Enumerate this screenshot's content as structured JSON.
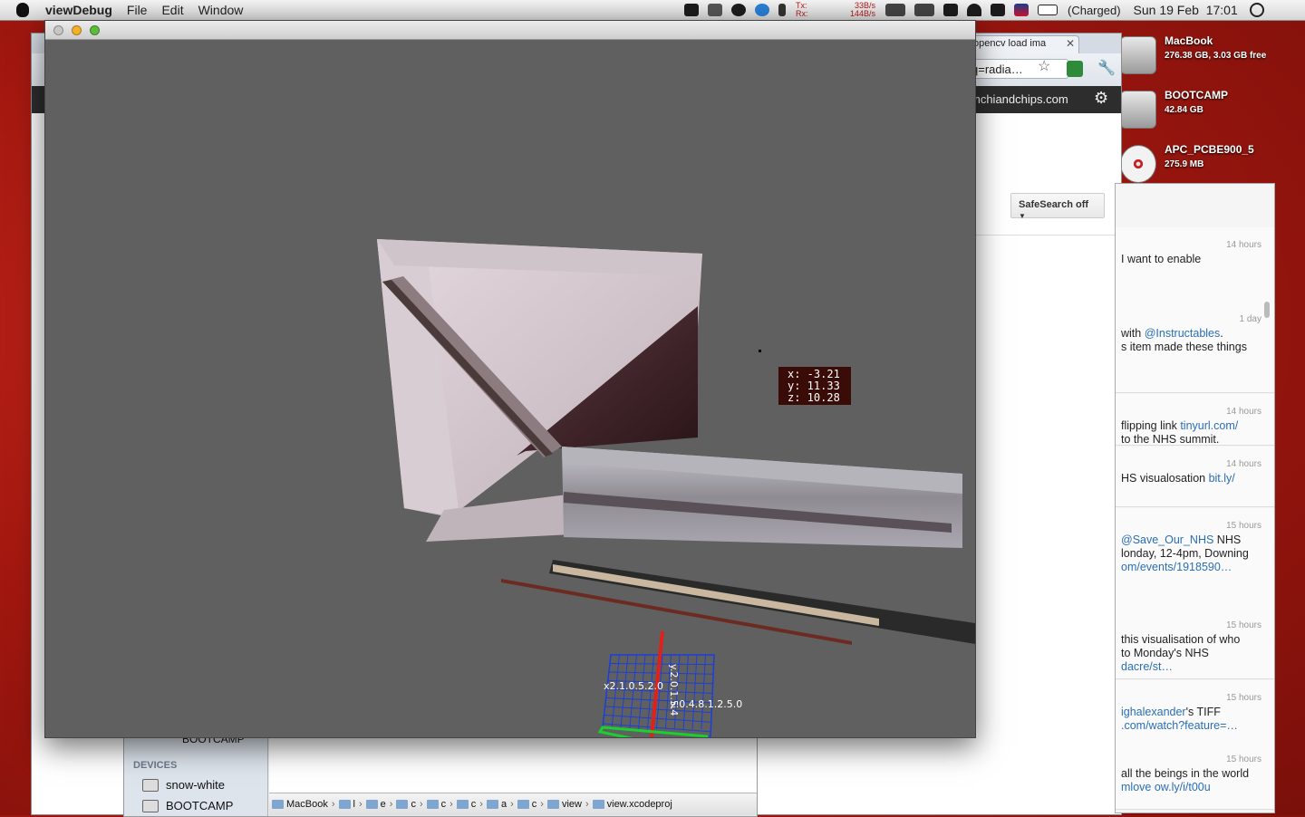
{
  "menubar": {
    "app_name": "viewDebug",
    "menus": [
      "File",
      "Edit",
      "Window"
    ],
    "net": {
      "tx_label": "Tx:",
      "tx_value": "33B/s",
      "rx_label": "Rx:",
      "rx_value": "144B/s"
    },
    "battery": "(Charged)",
    "clock": "Sun 19 Feb  17:01",
    "icons": [
      "dropbox-icon",
      "keyboard-icon",
      "lifesaver-icon",
      "twitter-bird-icon",
      "bluetooth-icon",
      "activity-graph-icon",
      "display-icon",
      "wifi-icon",
      "volume-icon",
      "uk-flag-icon",
      "battery-icon",
      "spotlight-search-icon"
    ]
  },
  "desktop": {
    "disks": [
      {
        "name": "MacBook",
        "size": "276.38 GB, 3.03 GB free"
      },
      {
        "name": "BOOTCAMP",
        "size": "42.84 GB"
      },
      {
        "name": "APC_PCBE900_5",
        "size": "275.9 MB"
      }
    ]
  },
  "browser": {
    "tab_title": "opencv load ima",
    "url": "q=radia…",
    "account": "mchiandchips.com",
    "safesearch": "SafeSearch off"
  },
  "twitter": {
    "tweets": [
      {
        "time": "14 hours",
        "lines": [
          [
            {
              "t": "I want to enable",
              "link": false
            }
          ]
        ]
      },
      {
        "time": "1 day",
        "lines": [
          [
            {
              "t": "with ",
              "link": false
            },
            {
              "t": "@Instructables",
              "link": true
            },
            {
              "t": ".",
              "link": false
            }
          ],
          [
            {
              "t": "s item made these things",
              "link": false
            }
          ]
        ]
      },
      {
        "time": "14 hours",
        "lines": [
          [
            {
              "t": "flipping link ",
              "link": false
            },
            {
              "t": "tinyurl.com/",
              "link": true
            }
          ],
          [
            {
              "t": "to the NHS summit.",
              "link": false
            }
          ]
        ]
      },
      {
        "time": "14 hours",
        "lines": [
          [
            {
              "t": "HS visualosation ",
              "link": false
            },
            {
              "t": "bit.ly/",
              "link": true
            }
          ]
        ]
      },
      {
        "time": "15 hours",
        "lines": [
          [
            {
              "t": "@Save_Our_NHS",
              "link": true
            },
            {
              "t": " NHS",
              "link": false
            }
          ],
          [
            {
              "t": "londay, 12-4pm, Downing",
              "link": false
            }
          ],
          [
            {
              "t": "om/events/1918590…",
              "link": true
            }
          ]
        ]
      },
      {
        "time": "15 hours",
        "lines": [
          [
            {
              "t": "this visualisation of who",
              "link": false
            }
          ],
          [
            {
              "t": "to Monday's NHS",
              "link": false
            }
          ],
          [
            {
              "t": "dacre/st…",
              "link": true
            }
          ]
        ]
      },
      {
        "time": "15 hours",
        "lines": [
          [
            {
              "t": "ighalexander",
              "link": true
            },
            {
              "t": "'s TIFF",
              "link": false
            }
          ],
          [
            {
              "t": ".com/watch?feature=…",
              "link": true
            }
          ]
        ]
      },
      {
        "time": "15 hours",
        "lines": [
          [
            {
              "t": "all the beings in the world",
              "link": false
            }
          ],
          [
            {
              "t": "mlove  ",
              "link": true
            },
            {
              "t": "ow.ly/i/t00u",
              "link": true
            }
          ]
        ]
      }
    ]
  },
  "finder": {
    "top_item": "BOOTCAMP",
    "devices_header": "DEVICES",
    "devices": [
      "snow-white",
      "BOOTCAMP"
    ],
    "path": [
      "MacBook",
      "l",
      "e",
      "c",
      "c",
      "c",
      "a",
      "c",
      "view",
      "view.xcodeproj"
    ]
  },
  "viewer": {
    "coords": {
      "x": "x: -3.21",
      "y": "y: 11.33",
      "z": "z: 10.28"
    },
    "axes_text": {
      "x_axis": "x2.1.0.5.2.0",
      "y_axis": "y.2.0.1.5.4",
      "z_axis": "z.0.4.8.1.2.5.0"
    }
  },
  "colors": {
    "viewport_bg": "#606060",
    "coord_box": "#3a0c08",
    "axis_x": "#1a3fd9",
    "axis_y": "#e0201a",
    "axis_z": "#18d030",
    "desktop": "#a31810"
  }
}
